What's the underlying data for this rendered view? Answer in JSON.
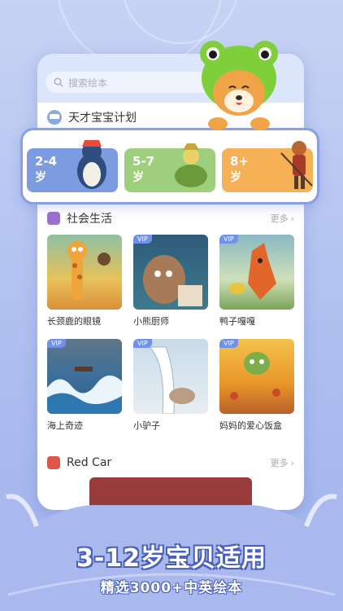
{
  "search": {
    "placeholder": "搜索绘本"
  },
  "plan": {
    "title": "天才宝宝计划"
  },
  "age_groups": [
    {
      "range": "2-4",
      "unit": "岁",
      "color": "#7d9be0"
    },
    {
      "range": "5-7",
      "unit": "岁",
      "color": "#9ecf7c"
    },
    {
      "range": "8+",
      "unit": "岁",
      "color": "#f6b157"
    }
  ],
  "section_social": {
    "title": "社会生活",
    "more": "更多"
  },
  "books": [
    {
      "title": "长颈鹿的眼镜",
      "vip": ""
    },
    {
      "title": "小熊厨师",
      "vip": "VIP"
    },
    {
      "title": "鸭子嘎嘎",
      "vip": "VIP"
    },
    {
      "title": "海上奇迹",
      "vip": "VIP"
    },
    {
      "title": "小驴子",
      "vip": "VIP"
    },
    {
      "title": "妈妈的爱心饭盒",
      "vip": "VIP"
    }
  ],
  "section_redcar": {
    "title": "Red Car",
    "more": "更多"
  },
  "banner": {
    "main": "3-12岁宝贝适用",
    "sub": "精选3000+中英绘本"
  },
  "icons": [
    "search-icon",
    "graduation-cap-icon",
    "book-icon",
    "car-icon",
    "chevron-right-icon",
    "frog-mascot-icon"
  ],
  "colors": {
    "accent": "#8a9ee6",
    "banner_outline": "#4a5fb8",
    "vip": "#6f92e8"
  }
}
